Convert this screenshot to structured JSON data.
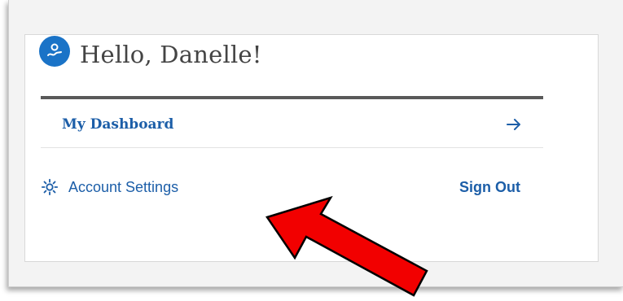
{
  "card": {
    "greeting": "Hello, Danelle!",
    "dashboard_label": "My Dashboard",
    "account_settings_label": "Account Settings",
    "sign_out_label": "Sign Out"
  },
  "icons": {
    "avatar": "user-wave-icon",
    "dashboard_arrow": "arrow-right-icon",
    "settings": "gear-icon",
    "annotation": "red-arrow-annotation"
  },
  "colors": {
    "link_blue": "#1c5ea8",
    "avatar_blue": "#1a73c7",
    "divider": "#595959",
    "annotation_red": "#f20000"
  }
}
